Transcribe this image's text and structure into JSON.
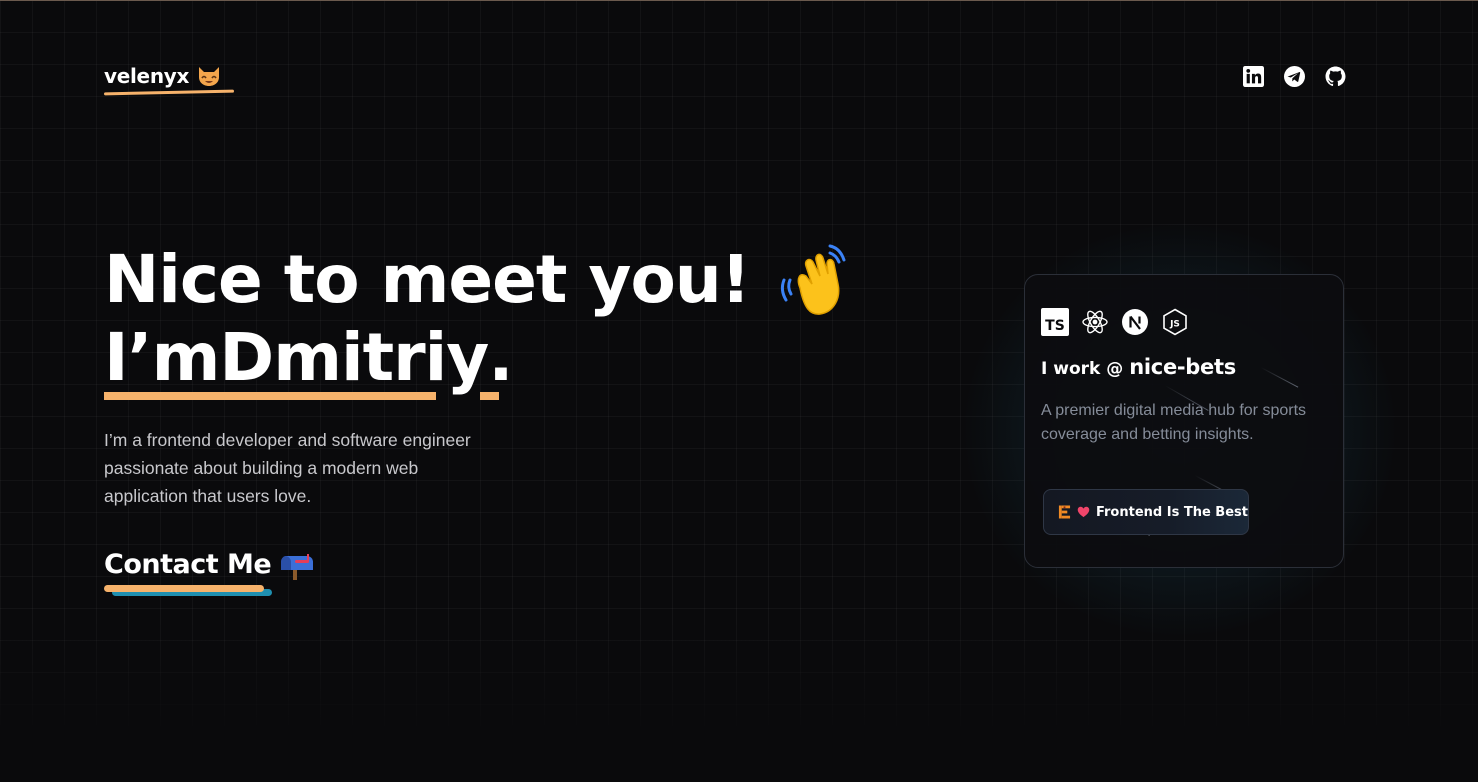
{
  "header": {
    "logo_text": "velenyx",
    "logo_emoji": "cat-face-icon",
    "social": [
      {
        "name": "LinkedIn",
        "icon": "linkedin-icon"
      },
      {
        "name": "Telegram",
        "icon": "telegram-icon"
      },
      {
        "name": "GitHub",
        "icon": "github-icon"
      }
    ]
  },
  "hero": {
    "line1": "Nice to meet you!",
    "greeting_icon": "waving-hand-icon",
    "line2_prefix": "I’m ",
    "name": "Dmitriy",
    "line2_suffix": ".",
    "intro": "I’m a frontend developer and software engineer passionate about building a modern web application that users love.",
    "cta_label": "Contact Me",
    "cta_icon": "mailbox-icon"
  },
  "work_card": {
    "tech_icons": [
      "typescript-icon",
      "react-icon",
      "nextjs-icon",
      "nodejs-icon"
    ],
    "prefix": "I work @",
    "company": "nice-bets",
    "description": "A premier digital media hub for sports coverage and betting insights.",
    "badge_icons": [
      "frontend-logo-icon",
      "heart-icon"
    ],
    "badge_label": "Frontend Is The Best"
  },
  "colors": {
    "background": "#0a0a0c",
    "accent_orange": "#f6b26b",
    "accent_teal": "#1f8fb0",
    "text_primary": "#ffffff",
    "text_muted": "#858c99"
  }
}
